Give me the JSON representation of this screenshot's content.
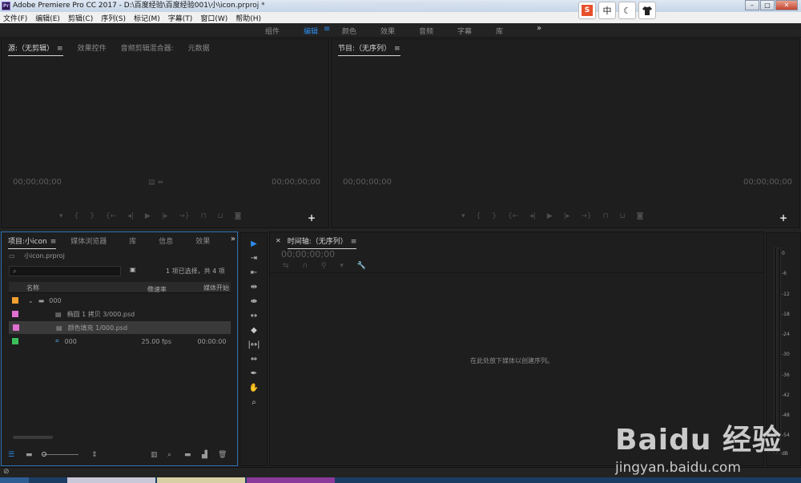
{
  "window": {
    "title": "Adobe Premiere Pro CC 2017 - D:\\百度经验\\百度经验001\\小\\icon.prproj *",
    "controls": [
      "–",
      "□",
      "✕"
    ]
  },
  "menubar": [
    "文件(F)",
    "编辑(E)",
    "剪辑(C)",
    "序列(S)",
    "标记(M)",
    "字幕(T)",
    "窗口(W)",
    "帮助(H)"
  ],
  "extension_toolbar": {
    "items": [
      "S",
      "中",
      "☾",
      "👕"
    ]
  },
  "workspaces": {
    "items": [
      "组件",
      "编辑",
      "颜色",
      "效果",
      "音频",
      "字幕",
      "库"
    ],
    "active": "编辑",
    "more": "»",
    "accent": "#2d8ceb"
  },
  "source_monitor": {
    "tabs": [
      "源:（无剪辑）",
      "效果控件",
      "音频剪辑混合器:",
      "元数据"
    ],
    "timecode_left": "00;00;00;00",
    "timecode_right": "00;00;00;00",
    "add_button": "+"
  },
  "program_monitor": {
    "tabs": [
      "节目:（无序列）"
    ],
    "timecode_left": "00;00;00;00",
    "timecode_right": "00;00;00;00",
    "add_button": "+"
  },
  "transport_controls": [
    "marker-icon",
    "in-point-icon",
    "out-point-icon",
    "go-to-in-icon",
    "step-back-icon",
    "play-icon",
    "step-forward-icon",
    "go-to-out-icon",
    "insert-icon",
    "overwrite-icon",
    "export-frame-icon"
  ],
  "project": {
    "tabs": [
      "项目:小icon",
      "媒体浏览器",
      "库",
      "信息",
      "效果"
    ],
    "more": "»",
    "filename": "小icon.prproj",
    "selection_info": "1 项已选择，共 4 项",
    "search_placeholder": "",
    "columns": [
      "名称",
      "帧速率",
      "媒体开始"
    ],
    "rows": [
      {
        "name": "000",
        "type": "bin",
        "color": "#f0a030",
        "fps": "",
        "start": "",
        "selected": false
      },
      {
        "name": "椭圆 1 拷贝 3/000.psd",
        "type": "psd",
        "color": "#e070d0",
        "fps": "",
        "start": "",
        "selected": false
      },
      {
        "name": "颜色填充 1/000.psd",
        "type": "psd",
        "color": "#e070d0",
        "fps": "",
        "start": "",
        "selected": true
      },
      {
        "name": "000",
        "type": "sequence",
        "color": "#3cbf5a",
        "fps": "25.00 fps",
        "start": "00:00:00:0",
        "selected": false
      }
    ]
  },
  "tools": [
    "selection-tool",
    "track-select-forward-tool",
    "track-select-backward-tool",
    "ripple-edit-tool",
    "rolling-edit-tool",
    "rate-stretch-tool",
    "razor-tool",
    "slip-tool",
    "slide-tool",
    "pen-tool",
    "hand-tool",
    "zoom-tool"
  ],
  "timeline": {
    "tab": "时间轴:（无序列）",
    "timecode": "00;00;00;00",
    "drop_hint": "在此处放下媒体以创建序列。"
  },
  "audio_meter": {
    "labels": [
      "0",
      "-6",
      "-12",
      "-18",
      "-24",
      "-30",
      "-36",
      "-42",
      "-48",
      "-54",
      "dB"
    ]
  },
  "watermark": {
    "logo": "Baidu 经验",
    "url": "jingyan.baidu.com"
  }
}
